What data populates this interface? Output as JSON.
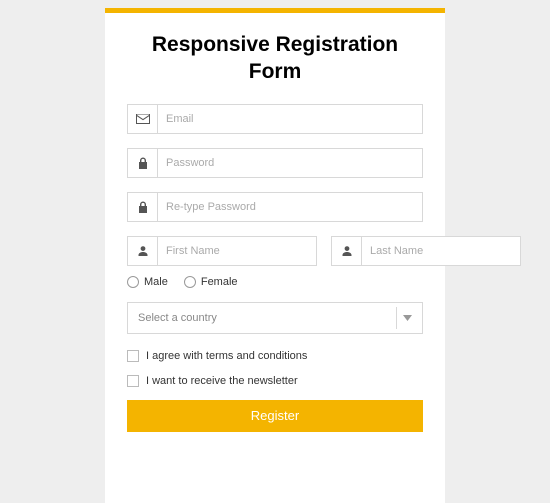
{
  "title": "Responsive Registration Form",
  "fields": {
    "email_placeholder": "Email",
    "password_placeholder": "Password",
    "repassword_placeholder": "Re-type Password",
    "first_name_placeholder": "First Name",
    "last_name_placeholder": "Last Name"
  },
  "gender": {
    "male": "Male",
    "female": "Female"
  },
  "country_placeholder": "Select a country",
  "checks": {
    "terms": "I agree with terms and conditions",
    "newsletter": "I want to receive the newsletter"
  },
  "register_label": "Register"
}
